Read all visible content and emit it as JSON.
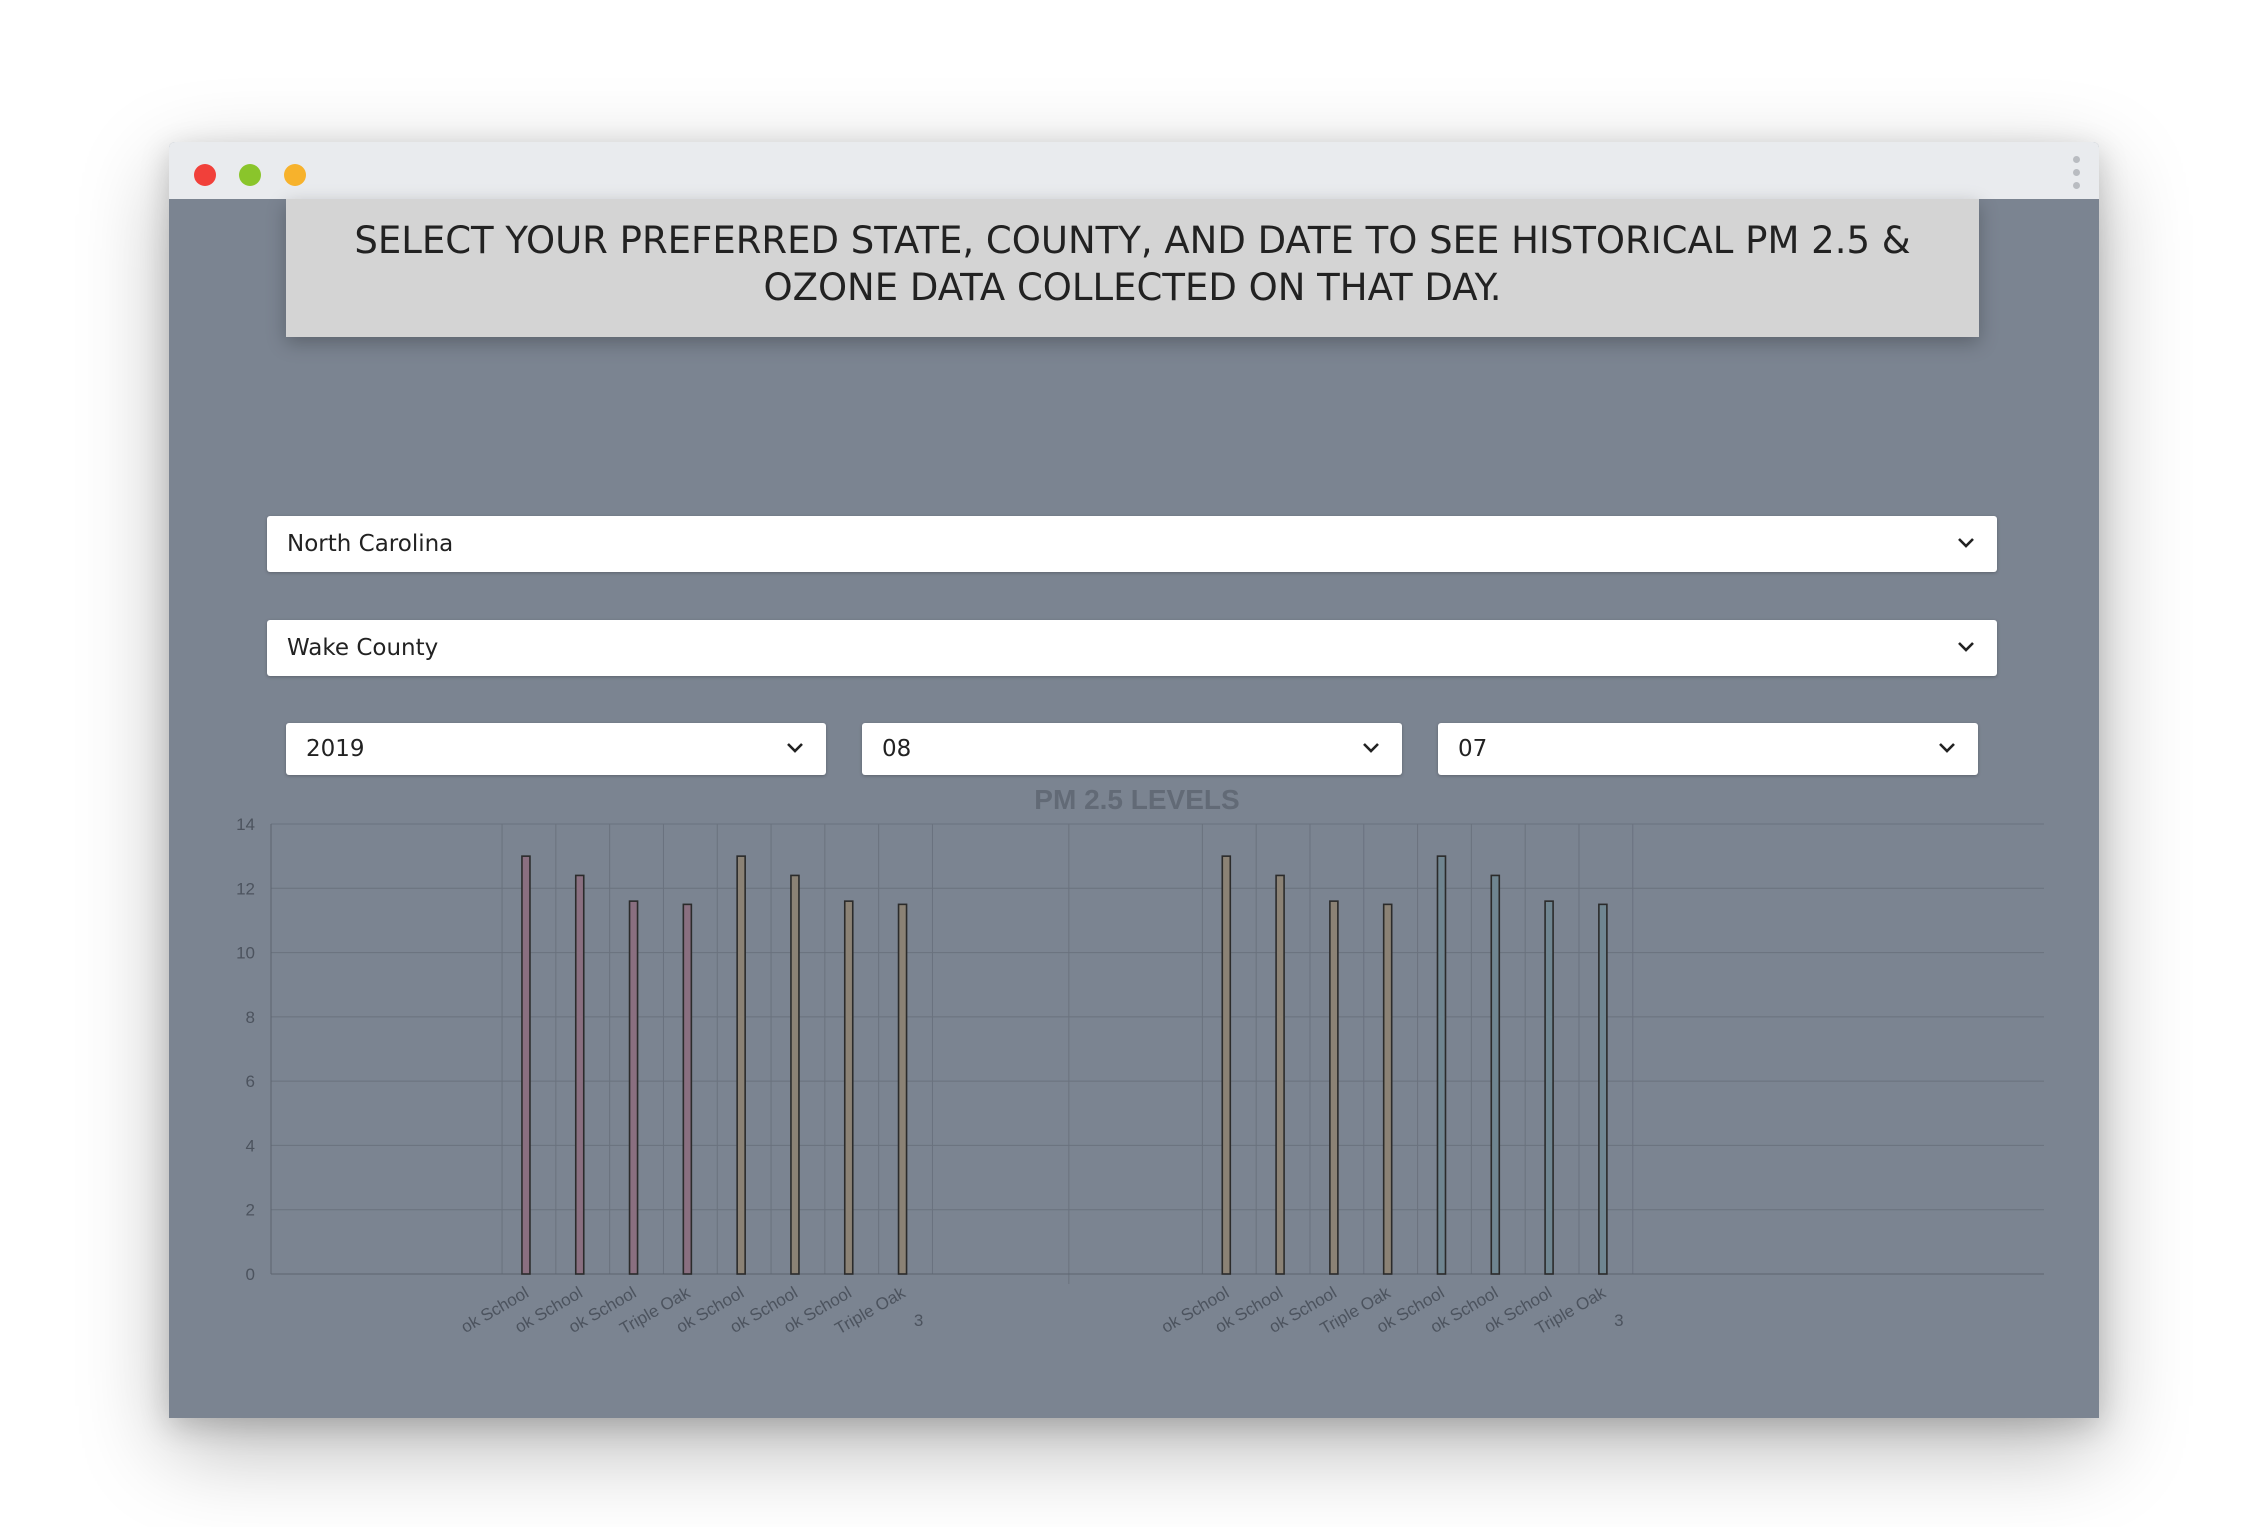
{
  "window": {
    "controls": {
      "close_color": "#f1403a",
      "minimize_color": "#8ac52b",
      "maximize_color": "#f7b22c"
    }
  },
  "banner": {
    "text": "SELECT YOUR PREFERRED STATE, COUNTY, AND DATE TO SEE HISTORICAL PM 2.5 & OZONE DATA COLLECTED ON THAT DAY."
  },
  "filters": {
    "state": {
      "value": "North Carolina",
      "icon": "chevron-down-icon"
    },
    "county": {
      "value": "Wake County",
      "icon": "chevron-down-icon"
    },
    "year": {
      "value": "2019",
      "icon": "chevron-down-icon"
    },
    "month": {
      "value": "08",
      "icon": "chevron-down-icon"
    },
    "day": {
      "value": "07",
      "icon": "chevron-down-icon"
    }
  },
  "chart_data": {
    "type": "bar",
    "title": "PM 2.5 LEVELS",
    "ylim": [
      0,
      14
    ],
    "yticks": [
      0,
      2,
      4,
      6,
      8,
      10,
      12,
      14
    ],
    "grid": true,
    "groups": [
      {
        "bars": [
          {
            "label": "ok School",
            "value": 13.0,
            "color": "#8a6f80"
          },
          {
            "label": "ok School",
            "value": 12.4,
            "color": "#8a6f80"
          },
          {
            "label": "ok School",
            "value": 11.6,
            "color": "#8a6f80"
          },
          {
            "label": "Triple Oak",
            "value": 11.5,
            "color": "#8a6f80"
          },
          {
            "label": "ok School",
            "value": 13.0,
            "color": "#8b8275"
          },
          {
            "label": "ok School",
            "value": 12.4,
            "color": "#8b8275"
          },
          {
            "label": "ok School",
            "value": 11.6,
            "color": "#8b8275"
          },
          {
            "label": "Triple Oak",
            "value": 11.5,
            "color": "#8b8275"
          }
        ],
        "extra_label": "3"
      },
      {
        "bars": [
          {
            "label": "ok School",
            "value": 13.0,
            "color": "#8b8275"
          },
          {
            "label": "ok School",
            "value": 12.4,
            "color": "#8b8275"
          },
          {
            "label": "ok School",
            "value": 11.6,
            "color": "#8b8275"
          },
          {
            "label": "Triple Oak",
            "value": 11.5,
            "color": "#8b8275"
          },
          {
            "label": "ok School",
            "value": 13.0,
            "color": "#6f8590"
          },
          {
            "label": "ok School",
            "value": 12.4,
            "color": "#6f8590"
          },
          {
            "label": "ok School",
            "value": 11.6,
            "color": "#6f8590"
          },
          {
            "label": "Triple Oak",
            "value": 11.5,
            "color": "#6f8590"
          }
        ],
        "extra_label": "3"
      }
    ]
  }
}
